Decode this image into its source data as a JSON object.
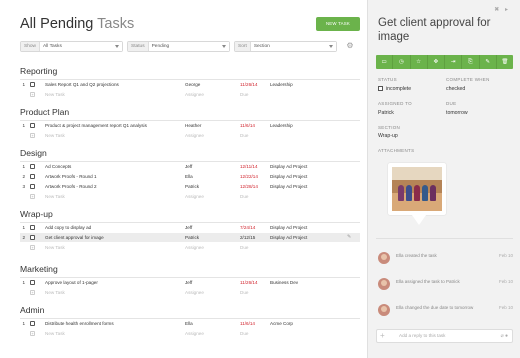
{
  "header": {
    "title_main": "All Pending",
    "title_muted": "Tasks",
    "new_task": "NEW TASK"
  },
  "filters": {
    "show_label": "Show",
    "show_value": "All Tasks",
    "status_label": "Status",
    "status_value": "Pending",
    "sort_label": "Sort",
    "sort_value": "Section"
  },
  "sections": [
    {
      "title": "Reporting",
      "tasks": [
        {
          "n": "1",
          "name": "Sales Report Q1 and Q2 projections",
          "assignee": "George",
          "due": "11/26/14",
          "overdue": true,
          "project": "Leadership"
        }
      ]
    },
    {
      "title": "Product Plan",
      "tasks": [
        {
          "n": "1",
          "name": "Product & project management report Q1 analysis",
          "assignee": "Heather",
          "due": "11/6/14",
          "overdue": true,
          "project": "Leadership"
        }
      ]
    },
    {
      "title": "Design",
      "tasks": [
        {
          "n": "1",
          "name": "Ad Concepts",
          "assignee": "Jeff",
          "due": "12/11/14",
          "overdue": true,
          "project": "Display Ad Project"
        },
        {
          "n": "2",
          "name": "Artwork Proofs - Round 1",
          "assignee": "Ella",
          "due": "12/22/14",
          "overdue": true,
          "project": "Display Ad Project"
        },
        {
          "n": "3",
          "name": "Artwork Proofs - Round 2",
          "assignee": "Patrick",
          "due": "12/28/14",
          "overdue": true,
          "project": "Display Ad Project"
        }
      ]
    },
    {
      "title": "Wrap-up",
      "tasks": [
        {
          "n": "1",
          "name": "Add copy to display ad",
          "assignee": "Jeff",
          "due": "7/24/14",
          "overdue": true,
          "project": "Display Ad Project"
        },
        {
          "n": "2",
          "name": "Get client approval for image",
          "assignee": "Patrick",
          "due": "2/12/15",
          "overdue": false,
          "project": "Display Ad Project"
        }
      ]
    },
    {
      "title": "Marketing",
      "tasks": [
        {
          "n": "1",
          "name": "Approve layout of 1-pager",
          "assignee": "Jeff",
          "due": "11/26/14",
          "overdue": true,
          "project": "Business Dev"
        }
      ]
    },
    {
      "title": "Admin",
      "tasks": [
        {
          "n": "1",
          "name": "Distribute health enrollment forms",
          "assignee": "Ella",
          "due": "11/6/14",
          "overdue": true,
          "project": "Acme Corp"
        }
      ]
    }
  ],
  "new_row": {
    "name": "New Task",
    "assignee": "Assignee",
    "due": "Due"
  },
  "detail": {
    "title": "Get client approval for image",
    "status_label": "STATUS",
    "status_value": "incomplete",
    "complete_when_label": "COMPLETE WHEN",
    "complete_when_value": "checked",
    "assigned_label": "ASSIGNED TO",
    "assigned_value": "Patrick",
    "due_label": "DUE",
    "due_value": "tomorrow",
    "section_label": "SECTION",
    "section_value": "Wrap-up",
    "attachments_label": "ATTACHMENTS",
    "activity": [
      {
        "text": "Ella created the task",
        "date": "Feb 10"
      },
      {
        "text": "Ella assigned the task to Patrick",
        "date": "Feb 10"
      },
      {
        "text": "Ella changed the due date to tomorrow",
        "date": "Feb 10"
      }
    ],
    "reply_placeholder": "Add a reply to this task"
  },
  "colors": {
    "accent": "#6bb34b",
    "overdue": "#d0202a"
  }
}
